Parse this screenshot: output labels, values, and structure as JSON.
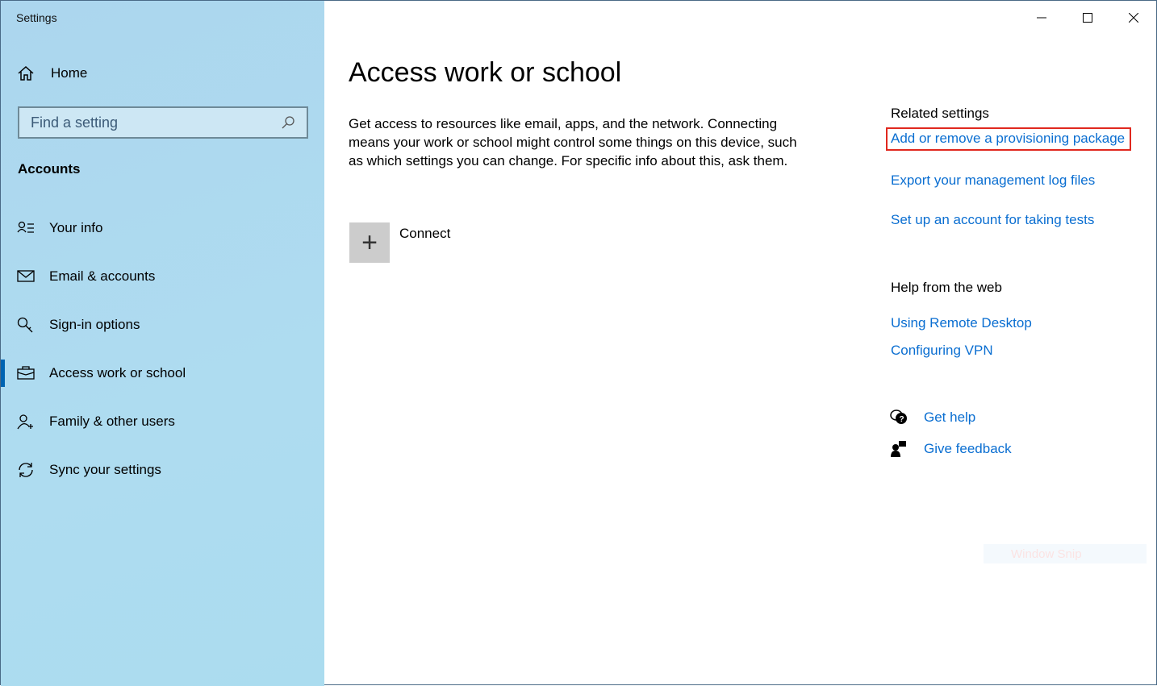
{
  "window": {
    "title": "Settings",
    "controls": {
      "minimize": "minimize-icon",
      "maximize": "maximize-icon",
      "close": "close-icon"
    }
  },
  "sidebar": {
    "home": "Home",
    "search": {
      "placeholder": "Find a setting",
      "value": ""
    },
    "section": "Accounts",
    "items": [
      {
        "label": "Your info",
        "icon": "person-list-icon"
      },
      {
        "label": "Email & accounts",
        "icon": "mail-icon"
      },
      {
        "label": "Sign-in options",
        "icon": "key-icon"
      },
      {
        "label": "Access work or school",
        "icon": "briefcase-icon",
        "active": true
      },
      {
        "label": "Family & other users",
        "icon": "person-add-icon"
      },
      {
        "label": "Sync your settings",
        "icon": "sync-icon"
      }
    ]
  },
  "main": {
    "title": "Access work or school",
    "description": "Get access to resources like email, apps, and the network. Connecting means your work or school might control some things on this device, such as which settings you can change. For specific info about this, ask them.",
    "connect": "Connect"
  },
  "related": {
    "heading": "Related settings",
    "links": [
      "Add or remove a provisioning package",
      "Export your management log files",
      "Set up an account for taking tests"
    ]
  },
  "web": {
    "heading": "Help from the web",
    "links": [
      "Using Remote Desktop",
      "Configuring VPN"
    ]
  },
  "help": {
    "get_help": "Get help",
    "give_feedback": "Give feedback"
  },
  "overlay": {
    "snip": "Window Snip"
  },
  "colors": {
    "accent": "#0063b1",
    "link": "#0a6ed1",
    "highlight": "#e0281e",
    "sidebar": "#acd8ef"
  }
}
